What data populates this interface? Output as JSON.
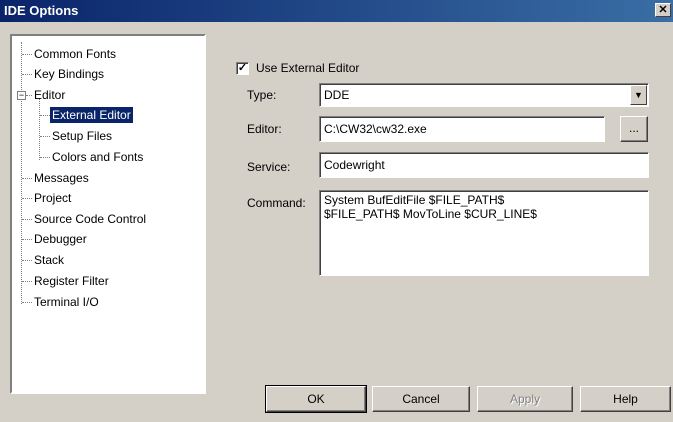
{
  "window": {
    "title": "IDE Options",
    "close_glyph": "✕"
  },
  "tree": {
    "items": [
      {
        "label": "Common Fonts",
        "level": 0
      },
      {
        "label": "Key Bindings",
        "level": 0
      },
      {
        "label": "Editor",
        "level": 0,
        "expander": "−"
      },
      {
        "label": "External Editor",
        "level": 1,
        "selected": true
      },
      {
        "label": "Setup Files",
        "level": 1
      },
      {
        "label": "Colors and Fonts",
        "level": 1
      },
      {
        "label": "Messages",
        "level": 0
      },
      {
        "label": "Project",
        "level": 0
      },
      {
        "label": "Source Code Control",
        "level": 0
      },
      {
        "label": "Debugger",
        "level": 0
      },
      {
        "label": "Stack",
        "level": 0
      },
      {
        "label": "Register Filter",
        "level": 0
      },
      {
        "label": "Terminal I/O",
        "level": 0
      }
    ]
  },
  "external_editor": {
    "use_label": "Use External Editor",
    "use_checked": "✓",
    "type_label": "Type:",
    "type_value": "DDE",
    "editor_label": "Editor:",
    "editor_value": "C:\\CW32\\cw32.exe",
    "browse_label": "...",
    "service_label": "Service:",
    "service_value": "Codewright",
    "command_label": "Command:",
    "command_value": "System BufEditFile $FILE_PATH$\n$FILE_PATH$ MovToLine $CUR_LINE$"
  },
  "buttons": {
    "ok": "OK",
    "cancel": "Cancel",
    "apply": "Apply",
    "help": "Help"
  },
  "colors": {
    "face": "#d4d0c8",
    "title_bar": "#0a246a",
    "selection": "#0a246a"
  }
}
